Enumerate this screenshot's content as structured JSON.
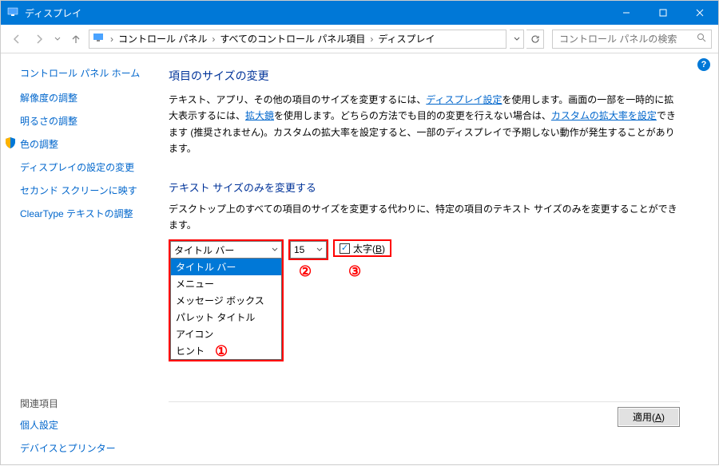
{
  "window": {
    "title": "ディスプレイ"
  },
  "breadcrumb": {
    "items": [
      "コントロール パネル",
      "すべてのコントロール パネル項目",
      "ディスプレイ"
    ]
  },
  "search": {
    "placeholder": "コントロール パネルの検索"
  },
  "sidebar": {
    "home": "コントロール パネル ホーム",
    "links": [
      "解像度の調整",
      "明るさの調整",
      "色の調整",
      "ディスプレイの設定の変更",
      "セカンド スクリーンに映す",
      "ClearType テキストの調整"
    ],
    "related_head": "関連項目",
    "related": [
      "個人設定",
      "デバイスとプリンター"
    ]
  },
  "main": {
    "h1": "項目のサイズの変更",
    "p1a": "テキスト、アプリ、その他の項目のサイズを変更するには、",
    "p1link1": "ディスプレイ設定",
    "p1b": "を使用します。画面の一部を一時的に拡大表示するには、",
    "p1link2": "拡大鏡",
    "p1c": "を使用します。どちらの方法でも目的の変更を行えない場合は、",
    "p1link3": "カスタムの拡大率を設定",
    "p1d": "できます (推奨されません)。カスタムの拡大率を設定すると、一部のディスプレイで予期しない動作が発生することがあります。",
    "h2": "テキスト サイズのみを変更する",
    "p2": "デスクトップ上のすべての項目のサイズを変更する代わりに、特定の項目のテキスト サイズのみを変更することができます。",
    "combo1": {
      "value": "タイトル バー",
      "options": [
        "タイトル バー",
        "メニュー",
        "メッセージ ボックス",
        "パレット タイトル",
        "アイコン",
        "ヒント"
      ]
    },
    "combo2": {
      "value": "15"
    },
    "bold_label_pre": "太字(",
    "bold_label_key": "B",
    "bold_label_post": ")",
    "bold_checked": true,
    "apply_pre": "適用(",
    "apply_key": "A",
    "apply_post": ")",
    "annotations": {
      "a1": "①",
      "a2": "②",
      "a3": "③"
    }
  }
}
